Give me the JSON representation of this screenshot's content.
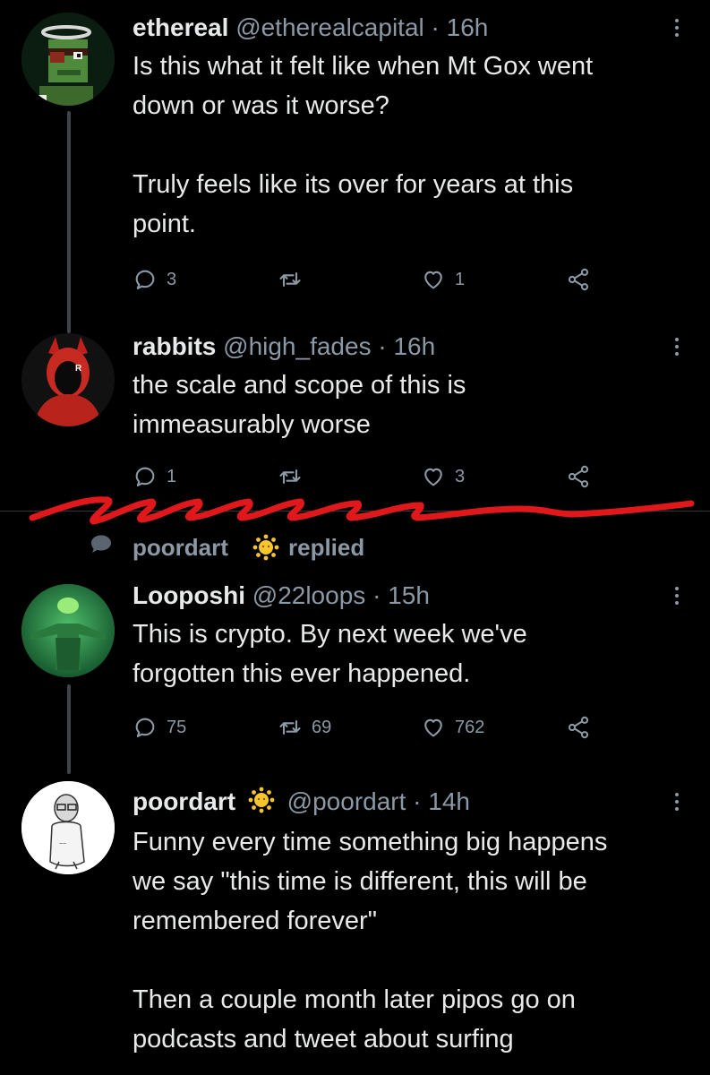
{
  "tweets": [
    {
      "name": "ethereal",
      "handle": "@etherealcapital",
      "dot": "·",
      "time": "16h",
      "body": [
        "Is this what it felt like when Mt Gox went",
        "down or was it worse?",
        "",
        "Truly feels like its over for years at this",
        "point."
      ],
      "replies": "3",
      "retweets": "",
      "likes": "1"
    },
    {
      "name": "rabbits",
      "handle": "@high_fades",
      "dot": "·",
      "time": "16h",
      "body": [
        "the scale and scope of this is",
        "immeasurably worse"
      ],
      "replies": "1",
      "retweets": "",
      "likes": "3"
    },
    {
      "name": "Looposhi",
      "handle": "@22loops",
      "dot": "·",
      "time": "15h",
      "body": [
        "This is crypto. By next week we've",
        "forgotten this ever happened."
      ],
      "replies": "75",
      "retweets": "69",
      "likes": "762"
    },
    {
      "name": "poordart",
      "handle": "@poordart",
      "dot": "·",
      "time": "14h",
      "body": [
        "Funny every time something big happens",
        "we say \"this time is different, this will be",
        "remembered forever\"",
        "",
        "Then a couple month later pipos go on",
        "podcasts and tweet about surfing"
      ],
      "replies": "",
      "retweets": "",
      "likes": ""
    }
  ],
  "replied_context": {
    "name": "poordart",
    "label": "replied"
  },
  "colors": {
    "background": "#000000",
    "text": "#e7e9ea",
    "secondary": "#8b98a5",
    "annotation_red": "#e0181c",
    "badge_yellow": "#f6c62a"
  },
  "icons": [
    "reply-icon",
    "retweet-icon",
    "like-icon",
    "share-icon",
    "more-icon",
    "sun-badge-icon",
    "speech-bubble-icon"
  ]
}
